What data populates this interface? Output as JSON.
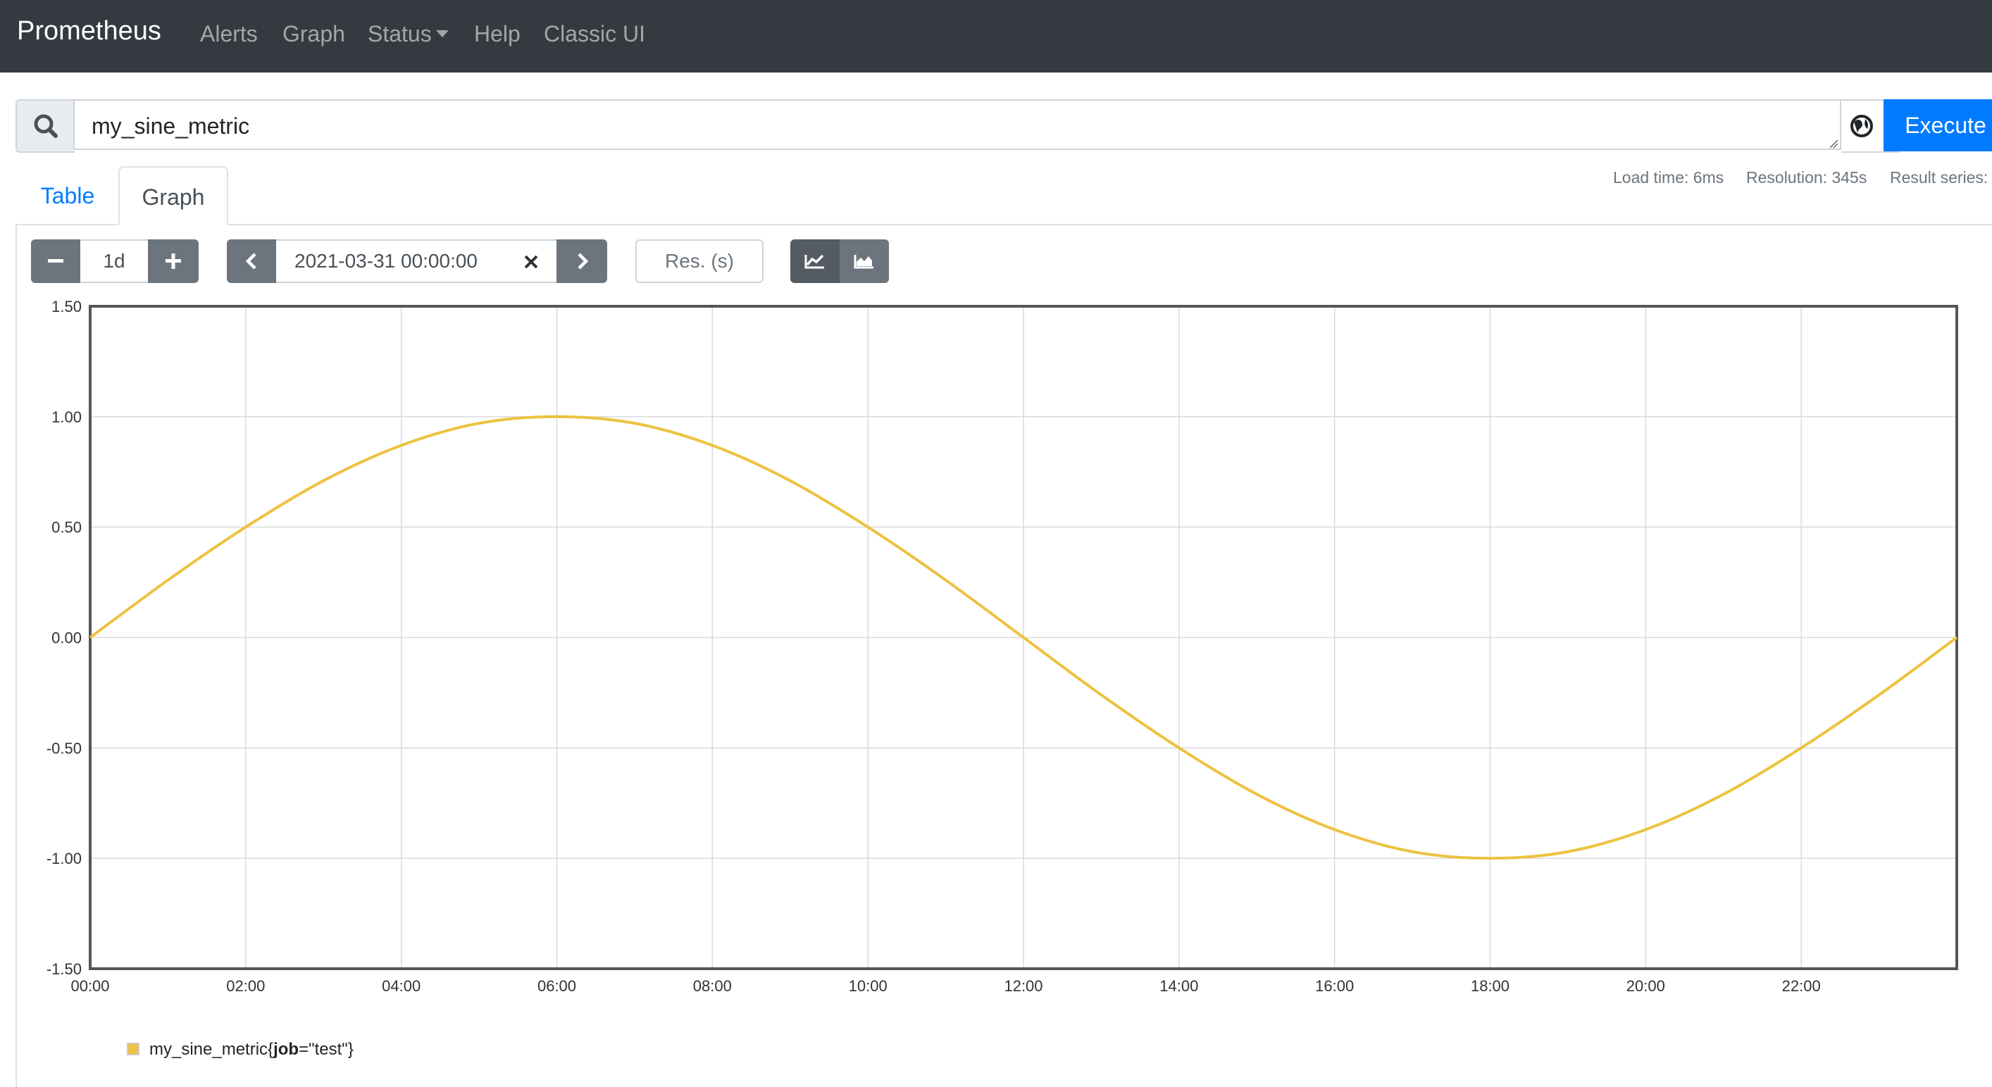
{
  "navbar": {
    "brand": "Prometheus",
    "items": [
      {
        "label": "Alerts"
      },
      {
        "label": "Graph"
      },
      {
        "label": "Status"
      },
      {
        "label": "Help"
      },
      {
        "label": "Classic UI"
      }
    ]
  },
  "query": {
    "expression": "my_sine_metric",
    "execute_label": "Execute",
    "search_icon": "search-icon",
    "globe_icon": "metrics-explorer-icon"
  },
  "stats": {
    "load_time": "Load time: 6ms",
    "resolution": "Resolution: 345s",
    "result_series": "Result series:"
  },
  "tabs": [
    {
      "label": "Table",
      "active": false
    },
    {
      "label": "Graph",
      "active": true
    }
  ],
  "controls": {
    "range": "1d",
    "end_time": "2021-03-31 00:00:00",
    "resolution_placeholder": "Res. (s)",
    "stacked": false
  },
  "colors": {
    "series": "#edc240",
    "accent": "#007bff",
    "navbar": "#343a40"
  },
  "chart_data": {
    "type": "line",
    "xlabel": "",
    "ylabel": "",
    "x_tick_labels": [
      "00:00",
      "02:00",
      "04:00",
      "06:00",
      "08:00",
      "10:00",
      "12:00",
      "14:00",
      "16:00",
      "18:00",
      "20:00",
      "22:00"
    ],
    "y_tick_labels": [
      "1.50",
      "1.00",
      "0.50",
      "0.00",
      "-0.50",
      "-1.00",
      "-1.50"
    ],
    "xlim_hours": [
      0,
      24
    ],
    "ylim": [
      -1.5,
      1.5
    ],
    "grid": true,
    "legend_position": "bottom-left",
    "series": [
      {
        "name": "my_sine_metric{job=\"test\"}",
        "legend_name": "my_sine_metric",
        "legend_key": "job",
        "legend_value": "\"test\"",
        "x_hours": [
          0,
          1,
          2,
          3,
          4,
          5,
          6,
          7,
          8,
          9,
          10,
          11,
          12,
          13,
          14,
          15,
          16,
          17,
          18,
          19,
          20,
          21,
          22,
          23,
          24
        ],
        "values": [
          0.0,
          0.26,
          0.5,
          0.71,
          0.87,
          0.97,
          1.0,
          0.97,
          0.87,
          0.71,
          0.5,
          0.26,
          0.0,
          -0.26,
          -0.5,
          -0.71,
          -0.87,
          -0.97,
          -1.0,
          -0.97,
          -0.87,
          -0.71,
          -0.5,
          -0.26,
          0.0
        ]
      }
    ]
  }
}
